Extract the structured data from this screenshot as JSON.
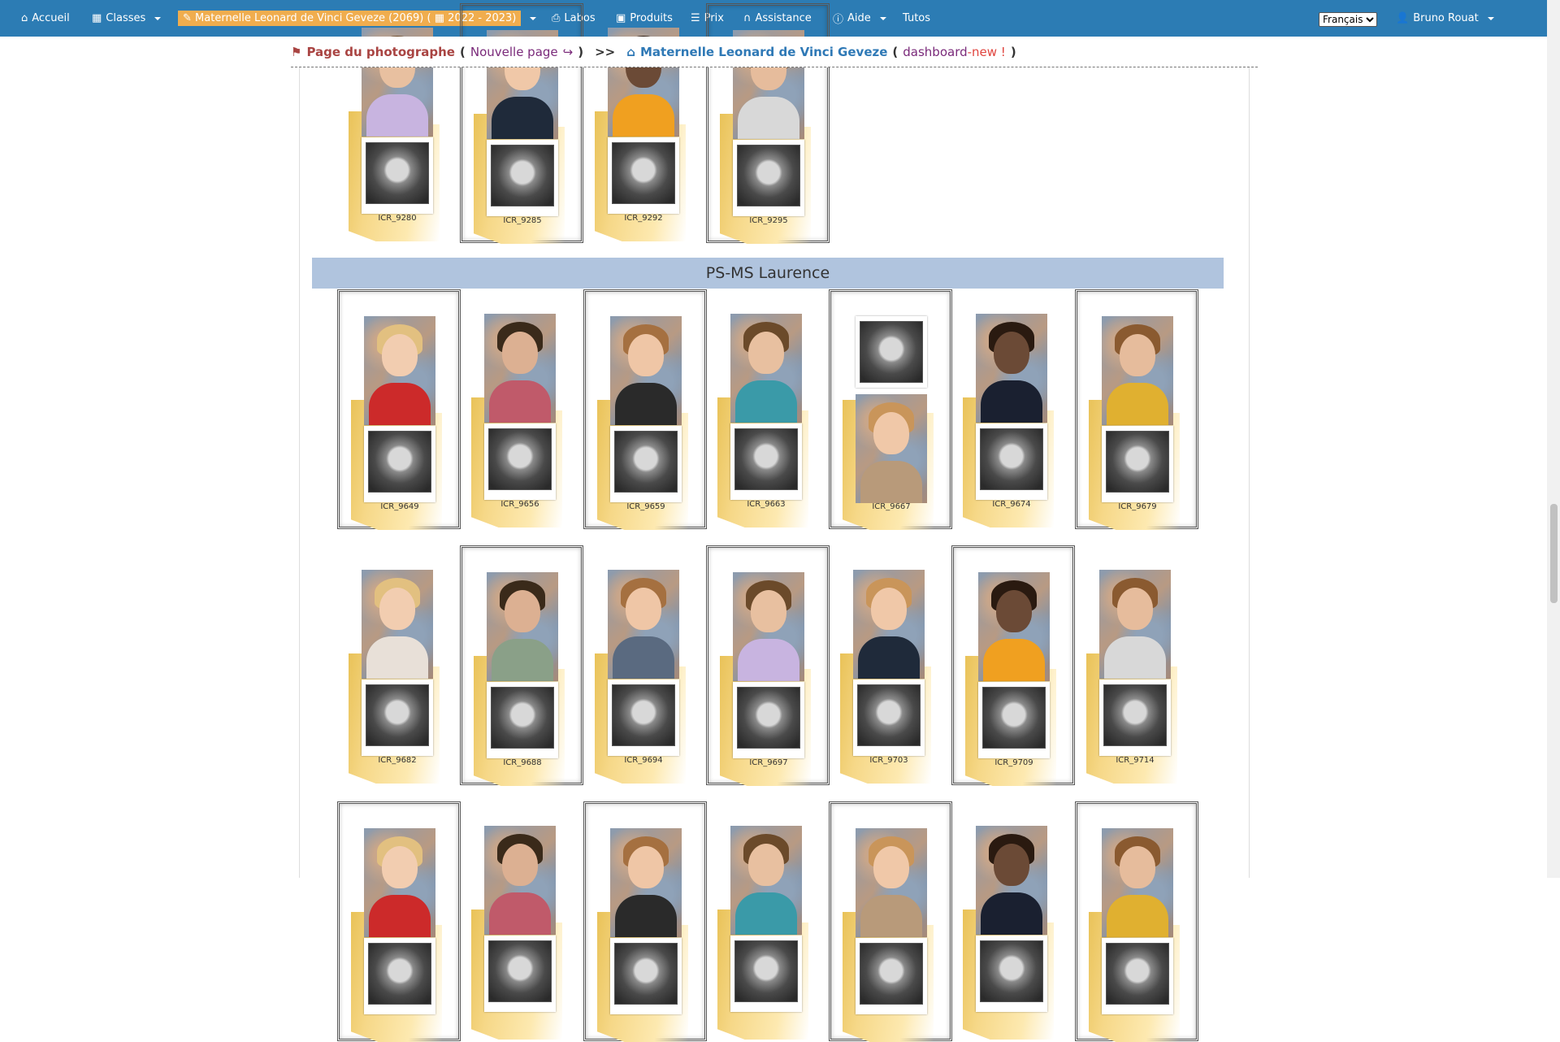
{
  "navbar": {
    "home": "Accueil",
    "classes": "Classes",
    "school": "Maternelle Leonard de Vinci Geveze (2069) (",
    "school_year": "2022 - 2023)",
    "labs": "Labos",
    "products": "Produits",
    "prices": "Prix",
    "assistance": "Assistance",
    "help": "Aide",
    "tutorials": "Tutos",
    "language": "Français",
    "user": "Bruno Rouat"
  },
  "breadcrumb": {
    "photographer_page": "Page du photographe",
    "open_paren": "(",
    "new_page": "Nouvelle page",
    "close_paren": ")",
    "separator": ">>",
    "school_link": "Maternelle Leonard de Vinci Geveze",
    "open_paren2": "(",
    "dashboard": "dashboard",
    "dashboard_new": "-new !",
    "close_paren2": ")"
  },
  "previous_class_row": {
    "photos": [
      {
        "label": "ICR_9280",
        "framed": false
      },
      {
        "label": "ICR_9285",
        "framed": true
      },
      {
        "label": "ICR_9292",
        "framed": false
      },
      {
        "label": "ICR_9295",
        "framed": true
      }
    ]
  },
  "class_section": {
    "title": "PS-MS Laurence",
    "rows": [
      [
        {
          "label": "ICR_9649",
          "framed": true
        },
        {
          "label": "ICR_9656",
          "framed": false
        },
        {
          "label": "ICR_9659",
          "framed": true
        },
        {
          "label": "ICR_9663",
          "framed": false
        },
        {
          "label": "ICR_9667",
          "framed": true,
          "swapped": true
        },
        {
          "label": "ICR_9674",
          "framed": false
        },
        {
          "label": "ICR_9679",
          "framed": true
        }
      ],
      [
        {
          "label": "ICR_9682",
          "framed": false
        },
        {
          "label": "ICR_9688",
          "framed": true
        },
        {
          "label": "ICR_9694",
          "framed": false
        },
        {
          "label": "ICR_9697",
          "framed": true
        },
        {
          "label": "ICR_9703",
          "framed": false
        },
        {
          "label": "ICR_9709",
          "framed": true
        },
        {
          "label": "ICR_9714",
          "framed": false
        }
      ],
      [
        {
          "label": "",
          "framed": true
        },
        {
          "label": "",
          "framed": false
        },
        {
          "label": "",
          "framed": true
        },
        {
          "label": "",
          "framed": false
        },
        {
          "label": "",
          "framed": true
        },
        {
          "label": "",
          "framed": false
        },
        {
          "label": "",
          "framed": true
        }
      ]
    ]
  },
  "colors": {
    "navbar": "#2c7cb4",
    "school_badge": "#f0ad4e",
    "class_header": "#b0c4de",
    "folder": "#f6d888"
  }
}
